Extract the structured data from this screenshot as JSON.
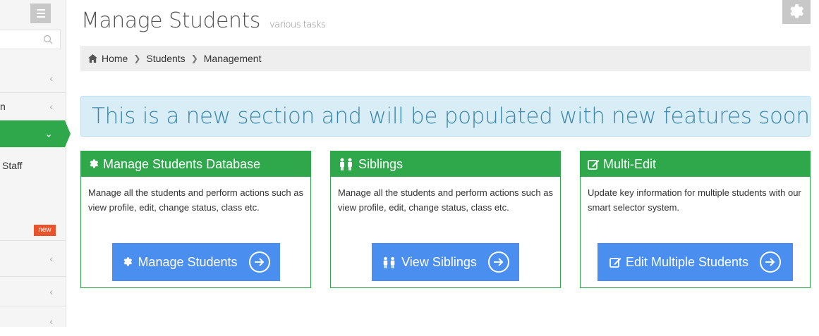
{
  "sidebar": {
    "items": [
      {
        "label": ""
      },
      {
        "label": "n"
      },
      {
        "label": ""
      },
      {
        "label": "Staff"
      },
      {
        "label": ""
      },
      {
        "label": "",
        "badge": "new"
      },
      {
        "label": ""
      },
      {
        "label": ""
      },
      {
        "label": ""
      }
    ]
  },
  "header": {
    "title": "Manage Students",
    "subtitle": "various tasks"
  },
  "breadcrumb": {
    "items": [
      "Home",
      "Students",
      "Management"
    ]
  },
  "notice": {
    "text": "This is a new section and will be populated with new features soon"
  },
  "cards": [
    {
      "icon": "gear-icon",
      "title": "Manage Students Database",
      "description": "Manage all the students and perform actions such as view profile, edit, change status, class etc.",
      "button": "Manage Students"
    },
    {
      "icon": "people-icon",
      "title": "Siblings",
      "description": "Manage all the students and perform actions such as view profile, edit, change status, class etc.",
      "button": "View Siblings"
    },
    {
      "icon": "edit-icon",
      "title": "Multi-Edit",
      "description": "Update key information for multiple students with our smart selector system.",
      "button": "Edit Multiple Students"
    }
  ],
  "colors": {
    "accent_green": "#2ea84a",
    "button_blue": "#4a8ef0",
    "notice_bg": "#d9edf7",
    "notice_text": "#3a87ad",
    "badge_red": "#e8532b"
  }
}
